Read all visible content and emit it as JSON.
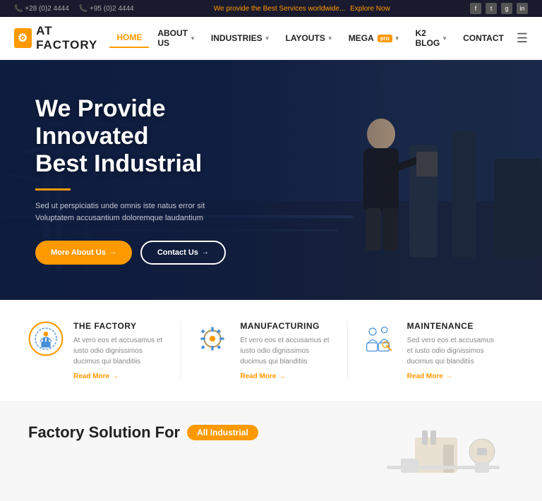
{
  "topbar": {
    "phone1": "+28 (0)2 4444",
    "phone2": "+95 (0)2 4444",
    "tagline": "We provide the Best Services worldwide...",
    "explore": "Explore Now",
    "social": [
      "f",
      "t",
      "g+",
      "in"
    ]
  },
  "header": {
    "logo_text": "AT FACTORY",
    "nav": [
      {
        "label": "HOME",
        "active": true,
        "hasDropdown": false
      },
      {
        "label": "ABOUT US",
        "active": false,
        "hasDropdown": true
      },
      {
        "label": "INDUSTRIES",
        "active": false,
        "hasDropdown": true
      },
      {
        "label": "LAYOUTS",
        "active": false,
        "hasDropdown": true
      },
      {
        "label": "MEGA",
        "active": false,
        "hasDropdown": true,
        "badge": "pro"
      },
      {
        "label": "K2 BLOG",
        "active": false,
        "hasDropdown": true
      },
      {
        "label": "CONTACT",
        "active": false,
        "hasDropdown": false
      }
    ]
  },
  "hero": {
    "title_line1": "We Provide Innovated",
    "title_line2": "Best Industrial",
    "desc": "Sed ut perspiciatis unde omnis iste natus error sit Voluptatem accusantium doloremque laudantium",
    "btn_about": "More About Us",
    "btn_contact": "Contact Us"
  },
  "features": [
    {
      "id": "factory",
      "title": "THE FACTORY",
      "desc": "At vero eos et accusamus et iusto odio dignissimos ducimus qui blanditiis",
      "link": "Read More"
    },
    {
      "id": "manufacturing",
      "title": "MANUFACTURING",
      "desc": "Et vero eos et accusamus et iusto odio dignissimos ducimus qui blanditiis",
      "link": "Read More"
    },
    {
      "id": "maintenance",
      "title": "MAINTENANCE",
      "desc": "Sed vero eos et accusamus et iusto odio dignissimos ducimus qui blanditiis",
      "link": "Read More"
    }
  ],
  "solution": {
    "title": "Factory Solution For",
    "badge": "All Industrial"
  },
  "colors": {
    "orange": "#f90",
    "dark": "#1a1a2e",
    "text": "#222"
  }
}
